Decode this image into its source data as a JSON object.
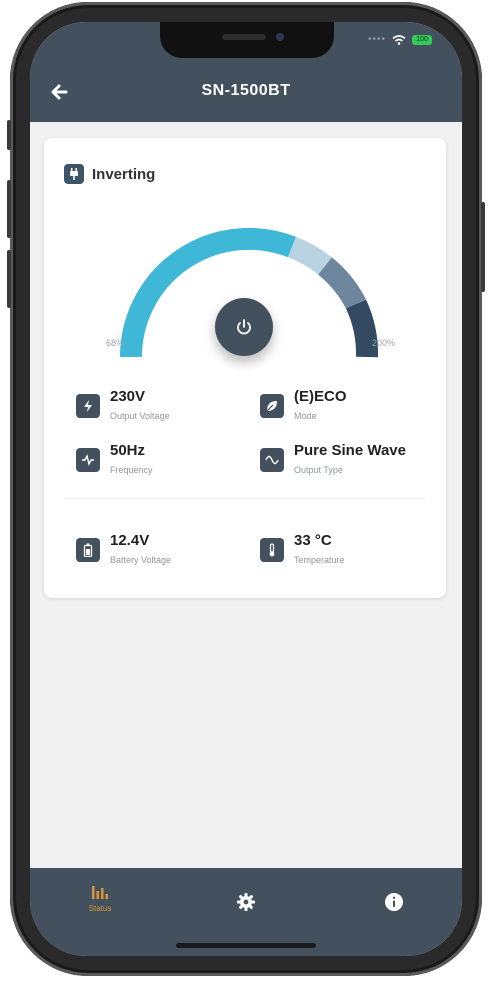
{
  "statusbar": {
    "battery": "100"
  },
  "header": {
    "title": "SN-1500BT"
  },
  "status_card": {
    "mode": "Inverting",
    "gauge": {
      "min_label": "68%",
      "max_label": "200%"
    }
  },
  "info": [
    {
      "value": "230V",
      "label": "Output Voltage",
      "icon": "lightning-icon"
    },
    {
      "value": "(E)ECO",
      "label": "Mode",
      "icon": "leaf-icon"
    },
    {
      "value": "50Hz",
      "label": "Frequency",
      "icon": "pulse-icon"
    },
    {
      "value": "Pure Sine Wave",
      "label": "Output Type",
      "icon": "sine-wave-icon"
    },
    {
      "value": "12.4V",
      "label": "Battery Voltage",
      "icon": "battery-icon"
    },
    {
      "value": "33 °C",
      "label": "Temperature",
      "icon": "thermometer-icon"
    }
  ],
  "tabbar": {
    "status_label": "Status",
    "active_color": "#d8953a"
  },
  "colors": {
    "header": "#43515e",
    "gauge_cyan": "#3fb8d8",
    "gauge_light": "#b9d3e3",
    "gauge_mid": "#6e879f",
    "gauge_dark": "#344a63"
  }
}
